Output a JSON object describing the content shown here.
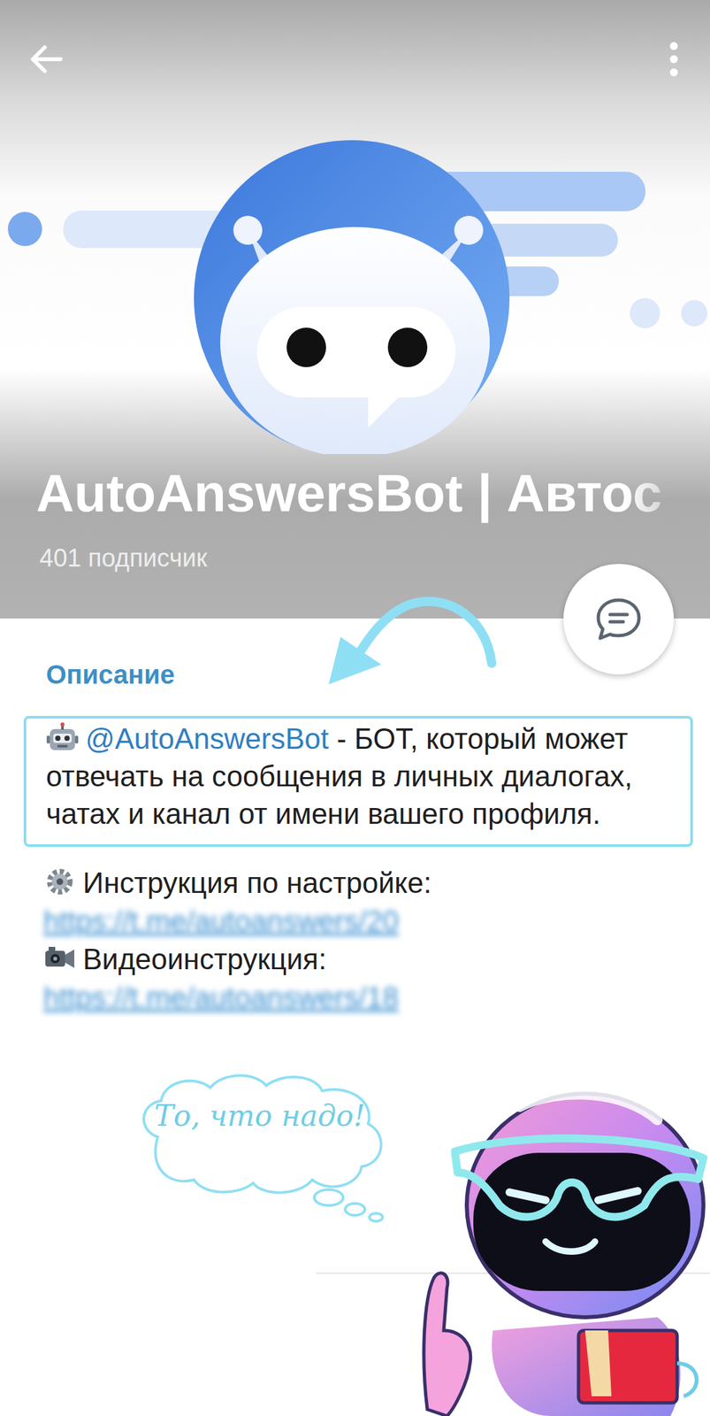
{
  "channel": {
    "title": "AutoAnswersBot | Автос",
    "subscribers": "401 подписчик"
  },
  "description": {
    "heading": "Описание",
    "mention": "@AutoAnswersBot",
    "text": " - БОТ, который может отвечать на сообщения в личных диалогах, чатах и канал от имени вашего профиля."
  },
  "links": [
    {
      "kind": "gear",
      "label": "Инструкция по настройке:",
      "url": "https://t.me/autoanswers/20"
    },
    {
      "kind": "camera",
      "label": "Видеоинструкция:",
      "url": "https://t.me/autoanswers/18"
    }
  ],
  "sticker": {
    "bubble": "То, что надо!"
  }
}
